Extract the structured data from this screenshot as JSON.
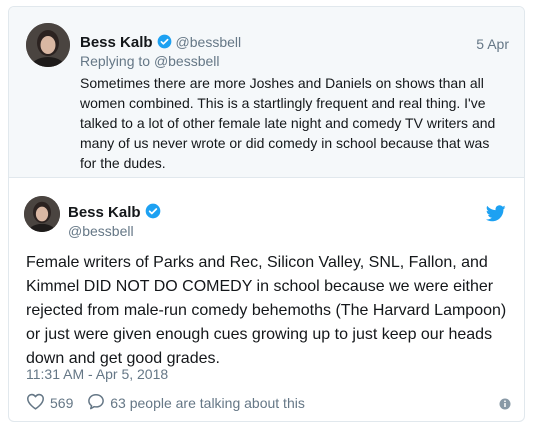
{
  "reply_tweet": {
    "author_name": "Bess Kalb",
    "author_handle": "@bessbell",
    "date": "5 Apr",
    "replying_to_prefix": "Replying to ",
    "replying_to_handle": "@bessbell",
    "text": "Sometimes there are more Joshes and Daniels on shows than all women combined. This is a startlingly frequent and real thing. I've talked to a lot of other female late night and comedy TV writers and many of us never wrote or did comedy in school because that was for the dudes."
  },
  "main_tweet": {
    "author_name": "Bess Kalb",
    "author_handle": "@bessbell",
    "text": "Female writers of Parks and Rec, Silicon Valley, SNL, Fallon, and Kimmel DID NOT DO COMEDY in school because we were either rejected from male-run comedy behemoths (The Harvard Lampoon) or just were given enough cues growing up to just keep our heads down and get good grades.",
    "timestamp": "11:31 AM - Apr 5, 2018",
    "like_count": "569",
    "talking_text": "63 people are talking about this"
  },
  "icons": {
    "verified": "verified-badge-icon",
    "bird": "twitter-bird-icon",
    "like": "heart-icon",
    "reply": "speech-bubble-icon",
    "info": "info-icon"
  },
  "colors": {
    "accent": "#1da1f2",
    "secondary_text": "#657786",
    "parent_background": "#f5f8fa",
    "border": "#e1e8ed"
  }
}
